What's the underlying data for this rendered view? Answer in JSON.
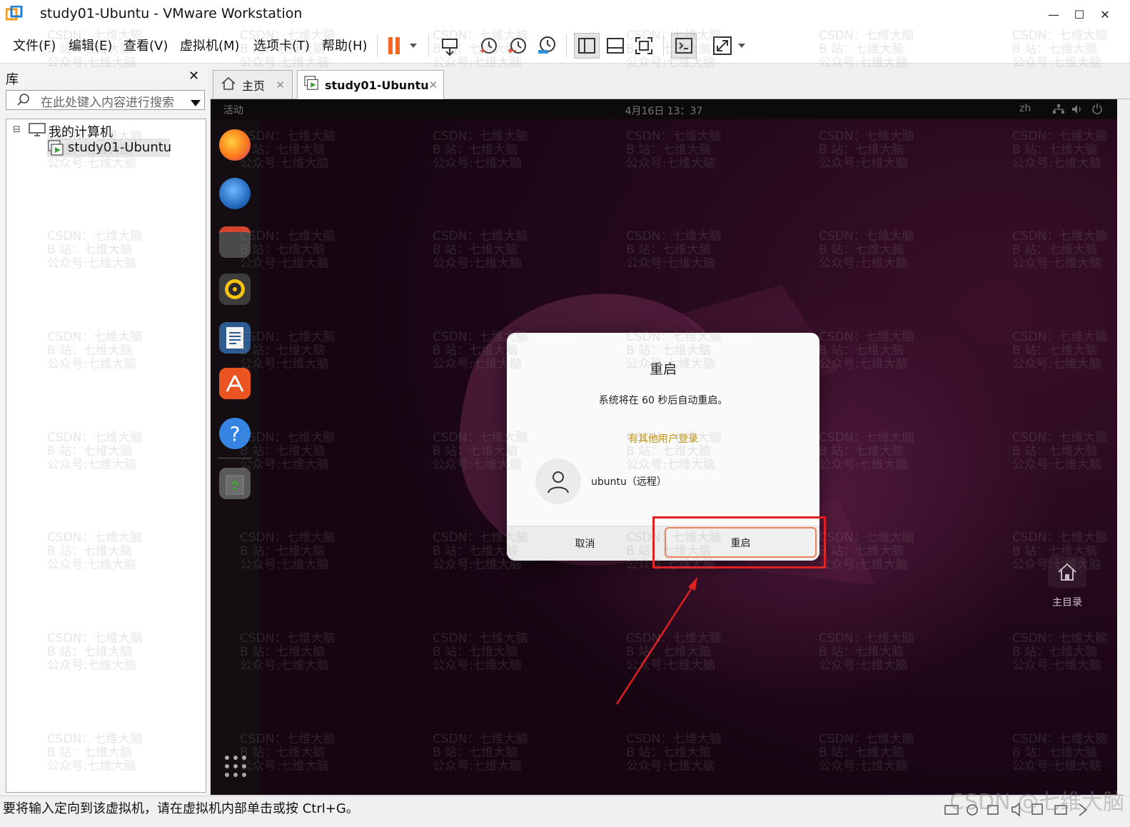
{
  "window": {
    "title": "study01-Ubuntu - VMware Workstation",
    "minimize_glyph": "—",
    "maximize_glyph": "☐",
    "close_glyph": "✕"
  },
  "menu": {
    "items": [
      "文件(F)",
      "编辑(E)",
      "查看(V)",
      "虚拟机(M)",
      "选项卡(T)",
      "帮助(H)"
    ]
  },
  "toolbar": {
    "icons": [
      "pause-icon",
      "send-ctrl-alt-del-icon",
      "snapshot-icon",
      "revert-snapshot-icon",
      "snapshot-manager-icon",
      "library-view-icon",
      "thumbnail-view-icon",
      "fullscreen-icon",
      "console-icon",
      "stretch-icon"
    ]
  },
  "library": {
    "title": "库",
    "close_glyph": "✕",
    "search_placeholder": "在此处键入内容进行搜索",
    "tree": {
      "root_label": "我的计算机",
      "expander": "⊟",
      "vm_label": "study01-Ubuntu"
    }
  },
  "tabs": [
    {
      "label": "主页",
      "close": "✕"
    },
    {
      "label": "study01-Ubuntu",
      "close": "✕"
    }
  ],
  "guest": {
    "activities": "活动",
    "clock": "4月16日  13：37",
    "lang": "zh",
    "dialog": {
      "title": "重启",
      "message": "系统将在 60 秒后自动重启。",
      "warning": "有其他用户登录",
      "user": "ubuntu（远程）",
      "cancel_label": "取消",
      "restart_label": "重启"
    },
    "home_label": "主目录"
  },
  "status": {
    "text": "要将输入定向到该虚拟机，请在虚拟机内部单击或按 Ctrl+G。"
  },
  "watermark": {
    "lines": "CSDN：七维大脑\nB 站：七维大脑\n公众号:七维大脑",
    "footer": "CSDN @七维大脑"
  },
  "colors": {
    "pause": "#f26522",
    "accent_orange": "#e9825d",
    "warn_text": "#c7940f",
    "annotation_red": "#e02020"
  }
}
